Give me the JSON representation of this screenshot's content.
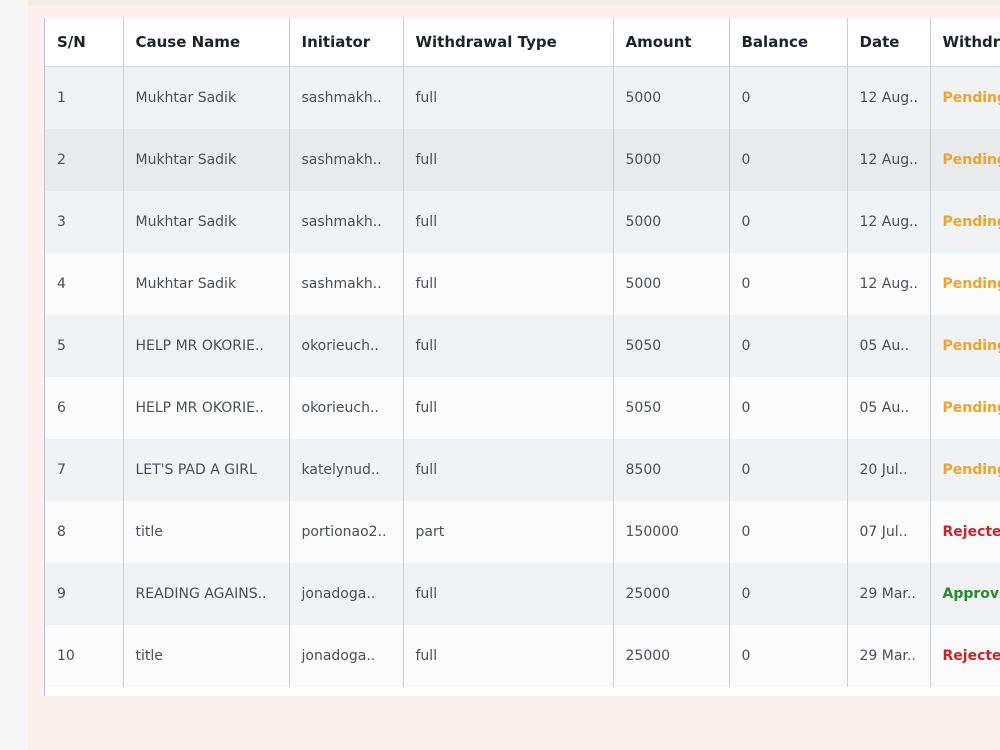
{
  "table": {
    "columns": [
      "S/N",
      "Cause Name",
      "Initiator",
      "Withdrawal Type",
      "Amount",
      "Balance",
      "Date",
      "Withdra"
    ],
    "rows": [
      {
        "sn": "1",
        "cause": "Mukhtar Sadik",
        "initiator": "sashmakh..",
        "type": "full",
        "amount": "5000",
        "balance": "0",
        "date": "12 Aug..",
        "status": "Pending",
        "status_kind": "pending"
      },
      {
        "sn": "2",
        "cause": "Mukhtar Sadik",
        "initiator": "sashmakh..",
        "type": "full",
        "amount": "5000",
        "balance": "0",
        "date": "12 Aug..",
        "status": "Pending",
        "status_kind": "pending"
      },
      {
        "sn": "3",
        "cause": "Mukhtar Sadik",
        "initiator": "sashmakh..",
        "type": "full",
        "amount": "5000",
        "balance": "0",
        "date": "12 Aug..",
        "status": "Pending",
        "status_kind": "pending"
      },
      {
        "sn": "4",
        "cause": "Mukhtar Sadik",
        "initiator": "sashmakh..",
        "type": "full",
        "amount": "5000",
        "balance": "0",
        "date": "12 Aug..",
        "status": "Pending",
        "status_kind": "pending"
      },
      {
        "sn": "5",
        "cause": "HELP MR OKORIE..",
        "initiator": "okorieuch..",
        "type": "full",
        "amount": "5050",
        "balance": "0",
        "date": "05 Au..",
        "status": "Pending",
        "status_kind": "pending"
      },
      {
        "sn": "6",
        "cause": "HELP MR OKORIE..",
        "initiator": "okorieuch..",
        "type": "full",
        "amount": "5050",
        "balance": "0",
        "date": "05 Au..",
        "status": "Pending",
        "status_kind": "pending"
      },
      {
        "sn": "7",
        "cause": "LET'S PAD A GIRL",
        "initiator": "katelynud..",
        "type": "full",
        "amount": "8500",
        "balance": "0",
        "date": "20 Jul..",
        "status": "Pending",
        "status_kind": "pending"
      },
      {
        "sn": "8",
        "cause": "title",
        "initiator": "portionao2..",
        "type": "part",
        "amount": "150000",
        "balance": "0",
        "date": "07 Jul..",
        "status": "Rejecte",
        "status_kind": "rejected"
      },
      {
        "sn": "9",
        "cause": "READING AGAINS..",
        "initiator": "jonadoga..",
        "type": "full",
        "amount": "25000",
        "balance": "0",
        "date": "29 Mar..",
        "status": "Approv",
        "status_kind": "approved"
      },
      {
        "sn": "10",
        "cause": "title",
        "initiator": "jonadoga..",
        "type": "full",
        "amount": "25000",
        "balance": "0",
        "date": "29 Mar..",
        "status": "Rejecte",
        "status_kind": "rejected"
      }
    ]
  },
  "colors": {
    "pending": "#f0a52a",
    "rejected": "#c8262c",
    "approved": "#2a8a2a"
  }
}
